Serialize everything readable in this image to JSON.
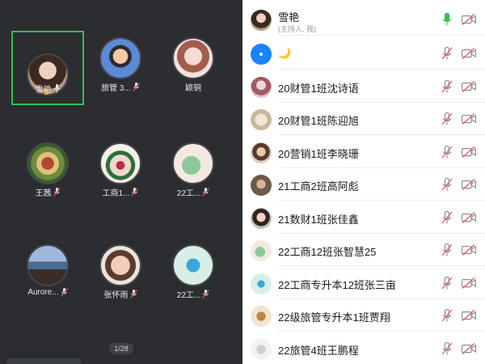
{
  "grid": {
    "tiles": [
      {
        "name": "雪艳"
      },
      {
        "name": "旅管 3..."
      },
      {
        "name": "颖铜"
      },
      {
        "name": "王茜"
      },
      {
        "name": "工商1..."
      },
      {
        "name": "22工..."
      },
      {
        "name": "Aurore..."
      },
      {
        "name": "张怀雨"
      },
      {
        "name": "22工..."
      }
    ],
    "page_indicator": "1/28"
  },
  "participants": [
    {
      "name": "雪艳",
      "subtitle": "(主持人, 我)",
      "mic": "on",
      "camera": "off"
    },
    {
      "name": "🌙",
      "mic": "muted",
      "camera": "off"
    },
    {
      "name": "20财管1班沈诗语",
      "mic": "muted",
      "camera": "off"
    },
    {
      "name": "20财管1班陈迎旭",
      "mic": "muted",
      "camera": "off"
    },
    {
      "name": "20营销1班李晓珊",
      "mic": "muted",
      "camera": "off"
    },
    {
      "name": "21工商2班高阿彪",
      "mic": "muted",
      "camera": "off"
    },
    {
      "name": "21数财1班张佳鑫",
      "mic": "muted",
      "camera": "off"
    },
    {
      "name": "22工商12班张智慧25",
      "mic": "muted",
      "camera": "off"
    },
    {
      "name": "22工商专升本12班张三亩",
      "mic": "muted",
      "camera": "off"
    },
    {
      "name": "22级旅管专升本1班贾翔",
      "mic": "muted",
      "camera": "off"
    },
    {
      "name": "22旅管4班王鹏程",
      "mic": "muted",
      "camera": "off"
    }
  ],
  "colors": {
    "active_border": "#2fbf4f",
    "mic_on": "#2fbf4f",
    "muted": "#e05a5a",
    "icon_gray": "#8e8e8e"
  }
}
